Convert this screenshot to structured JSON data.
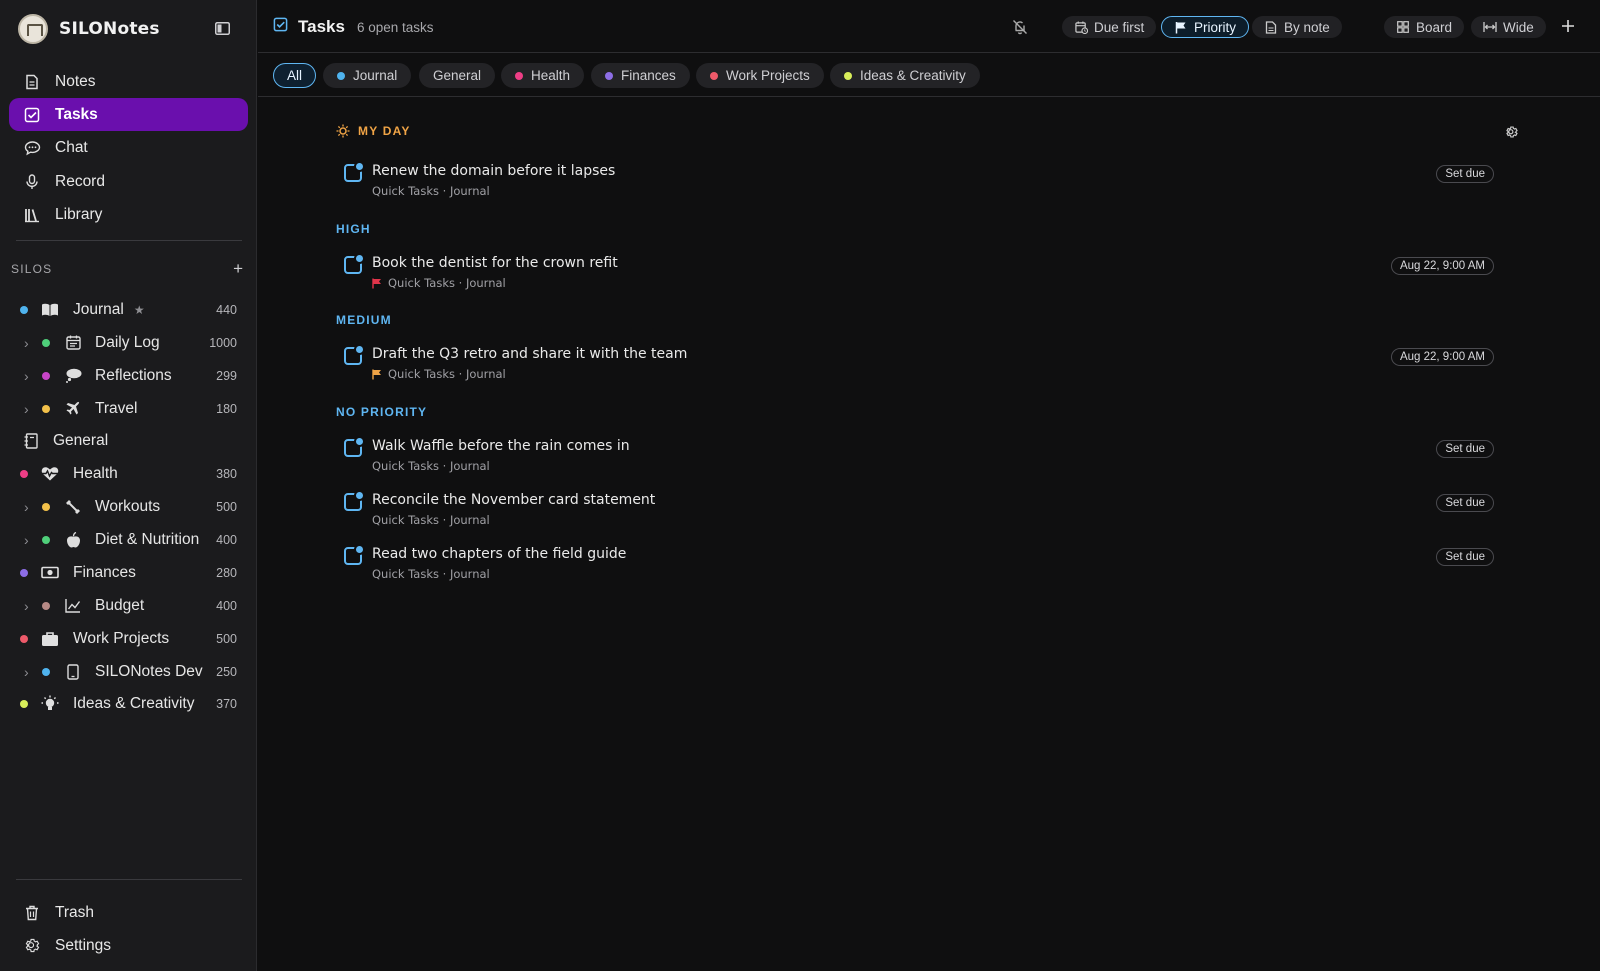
{
  "app": {
    "name": "SILONotes"
  },
  "nav": [
    {
      "label": "Notes",
      "icon": "notes-icon"
    },
    {
      "label": "Tasks",
      "icon": "tasks-icon",
      "active": true
    },
    {
      "label": "Chat",
      "icon": "chat-icon"
    },
    {
      "label": "Record",
      "icon": "microphone-icon"
    },
    {
      "label": "Library",
      "icon": "library-icon"
    }
  ],
  "silos": {
    "label": "SILOS",
    "add": "+",
    "items": [
      {
        "label": "Journal",
        "count": "440",
        "color": "#4fb3ee",
        "icon": "book-icon",
        "starred": "★"
      },
      {
        "label": "Daily Log",
        "count": "1000",
        "color": "#4fcf7a",
        "icon": "calendar-icon",
        "child": true
      },
      {
        "label": "Reflections",
        "count": "299",
        "color": "#c845c8",
        "icon": "thought-icon",
        "child": true
      },
      {
        "label": "Travel",
        "count": "180",
        "color": "#f3c14a",
        "icon": "plane-icon",
        "child": true
      },
      {
        "label": "General",
        "count": "",
        "color": "",
        "icon": "notebook-icon"
      },
      {
        "label": "Health",
        "count": "380",
        "color": "#ee3e86",
        "icon": "heartbeat-icon"
      },
      {
        "label": "Workouts",
        "count": "500",
        "color": "#f3c14a",
        "icon": "dumbbell-icon",
        "child": true
      },
      {
        "label": "Diet & Nutrition",
        "count": "400",
        "color": "#4fcf7a",
        "icon": "apple-icon",
        "child": true
      },
      {
        "label": "Finances",
        "count": "280",
        "color": "#8d6ee6",
        "icon": "money-icon"
      },
      {
        "label": "Budget",
        "count": "400",
        "color": "#b78a86",
        "icon": "chart-line-icon",
        "child": true
      },
      {
        "label": "Work Projects",
        "count": "500",
        "color": "#ee5a6a",
        "icon": "briefcase-icon"
      },
      {
        "label": "SILONotes Dev",
        "count": "250",
        "color": "#4fb3ee",
        "icon": "phone-icon",
        "child": true
      },
      {
        "label": "Ideas & Creativity",
        "count": "370",
        "color": "#d8ee5a",
        "icon": "bulb-icon"
      }
    ]
  },
  "bottom_nav": [
    {
      "label": "Trash",
      "icon": "trash-icon"
    },
    {
      "label": "Settings",
      "icon": "gear-icon"
    }
  ],
  "header": {
    "title": "Tasks",
    "subtitle": "6 open tasks",
    "sort_buttons": [
      {
        "label": "Due first",
        "icon": "calendar-clock-icon"
      },
      {
        "label": "Priority",
        "icon": "flag-icon",
        "active": true
      },
      {
        "label": "By note",
        "icon": "note-icon"
      }
    ],
    "view_buttons": [
      {
        "label": "Board",
        "icon": "board-icon"
      },
      {
        "label": "Wide",
        "icon": "wide-icon"
      }
    ]
  },
  "filters": [
    {
      "label": "All",
      "active": true,
      "color": ""
    },
    {
      "label": "Journal",
      "color": "#4fb3ee"
    },
    {
      "label": "General",
      "color": ""
    },
    {
      "label": "Health",
      "color": "#ee3e86"
    },
    {
      "label": "Finances",
      "color": "#8d6ee6"
    },
    {
      "label": "Work Projects",
      "color": "#ee5a6a"
    },
    {
      "label": "Ideas & Creativity",
      "color": "#d8ee5a"
    }
  ],
  "sections": [
    {
      "label": "MY DAY"
    },
    {
      "label": "HIGH"
    },
    {
      "label": "MEDIUM"
    },
    {
      "label": "NO PRIORITY"
    }
  ],
  "tasks": [
    {
      "title": "Renew the domain before it lapses",
      "meta": "Quick Tasks · Journal",
      "due": "Set due",
      "flag": ""
    },
    {
      "title": "Book the dentist for the crown refit",
      "meta": "Quick Tasks · Journal",
      "due": "Aug 22, 9:00 AM",
      "flag": "#e2344a"
    },
    {
      "title": "Draft the Q3 retro and share it with the team",
      "meta": "Quick Tasks · Journal",
      "due": "Aug 22, 9:00 AM",
      "flag": "#f0a446"
    },
    {
      "title": "Walk Waffle before the rain comes in",
      "meta": "Quick Tasks · Journal",
      "due": "Set due",
      "flag": ""
    },
    {
      "title": "Reconcile the November card statement",
      "meta": "Quick Tasks · Journal",
      "due": "Set due",
      "flag": ""
    },
    {
      "title": "Read two chapters of the field guide",
      "meta": "Quick Tasks · Journal",
      "due": "Set due",
      "flag": ""
    }
  ],
  "colors": {
    "accent": "#5fb6f2",
    "active_nav": "#6a0fad",
    "my_day": "#f0a446"
  }
}
